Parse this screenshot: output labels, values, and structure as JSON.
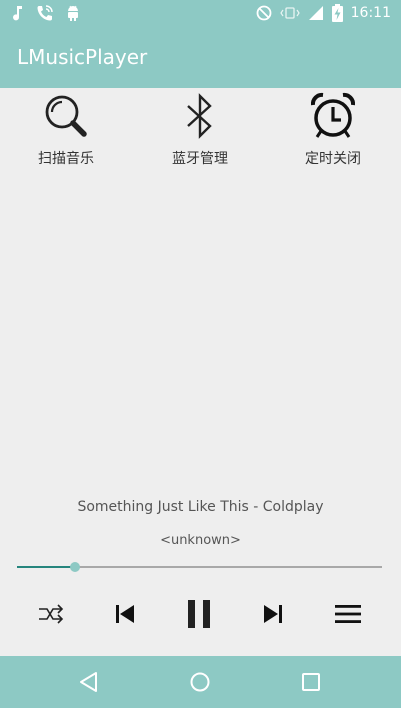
{
  "status_bar": {
    "time": "16:11",
    "left_icons": [
      "music-note-icon",
      "phone-call-icon",
      "android-icon"
    ],
    "right_icons": [
      "dnd-icon",
      "vibrate-icon",
      "signal-icon",
      "battery-charging-icon"
    ]
  },
  "app_bar": {
    "title": "LMusicPlayer"
  },
  "features": [
    {
      "label": "扫描音乐",
      "icon": "search-icon"
    },
    {
      "label": "蓝牙管理",
      "icon": "bluetooth-icon"
    },
    {
      "label": "定时关闭",
      "icon": "alarm-clock-icon"
    }
  ],
  "now_playing": {
    "title": "Something Just Like This - Coldplay",
    "artist": "<unknown>",
    "progress": 0.16
  },
  "controls": [
    "shuffle-icon",
    "previous-icon",
    "pause-icon",
    "next-icon",
    "playlist-icon"
  ],
  "nav_bar": [
    "back-icon",
    "home-icon",
    "recents-icon"
  ],
  "colors": {
    "primary": "#8dc9c4",
    "accent": "#26857d",
    "background": "#eeeeee",
    "text": "#333333"
  }
}
